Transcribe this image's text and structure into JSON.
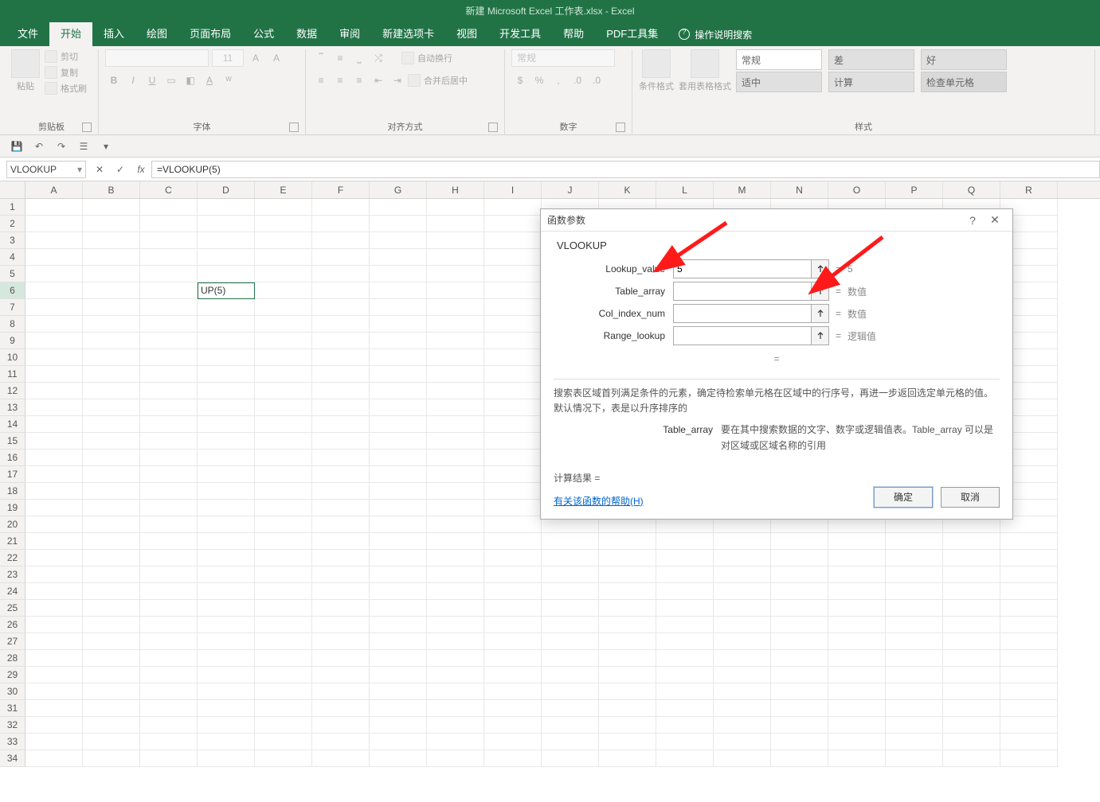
{
  "title": "新建 Microsoft Excel 工作表.xlsx  -  Excel",
  "tabs": [
    "文件",
    "开始",
    "插入",
    "绘图",
    "页面布局",
    "公式",
    "数据",
    "审阅",
    "新建选项卡",
    "视图",
    "开发工具",
    "帮助",
    "PDF工具集"
  ],
  "active_tab_index": 1,
  "tell_me": "操作说明搜索",
  "ribbon": {
    "clipboard": {
      "paste": "粘贴",
      "cut": "剪切",
      "copy": "复制",
      "painter": "格式刷",
      "label": "剪贴板"
    },
    "font": {
      "size": "11",
      "label": "字体"
    },
    "alignment": {
      "wrap": "自动换行",
      "merge": "合并后居中",
      "label": "对齐方式"
    },
    "number": {
      "general": "常规",
      "label": "数字"
    },
    "styles": {
      "cond": "条件格式",
      "tablefmt": "套用表格格式",
      "cells": [
        "常规",
        "差",
        "好",
        "适中",
        "计算",
        "检查单元格"
      ],
      "label": "样式"
    }
  },
  "formula_bar": {
    "namebox": "VLOOKUP",
    "formula": "=VLOOKUP(5)",
    "fx": "fx"
  },
  "grid": {
    "columns": [
      "A",
      "B",
      "C",
      "D",
      "E",
      "F",
      "G",
      "H",
      "I",
      "J",
      "K",
      "L",
      "M",
      "N",
      "O",
      "P",
      "Q",
      "R"
    ],
    "row_count": 34,
    "active_row": 6,
    "active_col": "D",
    "active_cell_text": "UP(5)"
  },
  "dialog": {
    "title": "函数参数",
    "func": "VLOOKUP",
    "args": [
      {
        "label": "Lookup_value",
        "value": "5",
        "result": "5"
      },
      {
        "label": "Table_array",
        "value": "",
        "result": "数值"
      },
      {
        "label": "Col_index_num",
        "value": "",
        "result": "数值"
      },
      {
        "label": "Range_lookup",
        "value": "",
        "result": "逻辑值"
      }
    ],
    "eq_only": "=",
    "desc": "搜索表区域首列满足条件的元素，确定待检索单元格在区域中的行序号，再进一步返回选定单元格的值。默认情况下，表是以升序排序的",
    "param_name": "Table_array",
    "param_desc": "要在其中搜索数据的文字、数字或逻辑值表。Table_array 可以是对区域或区域名称的引用",
    "result_label": "计算结果 =",
    "help": "有关该函数的帮助(H)",
    "ok": "确定",
    "cancel": "取消",
    "help_btn": "?",
    "close_btn": "✕"
  }
}
